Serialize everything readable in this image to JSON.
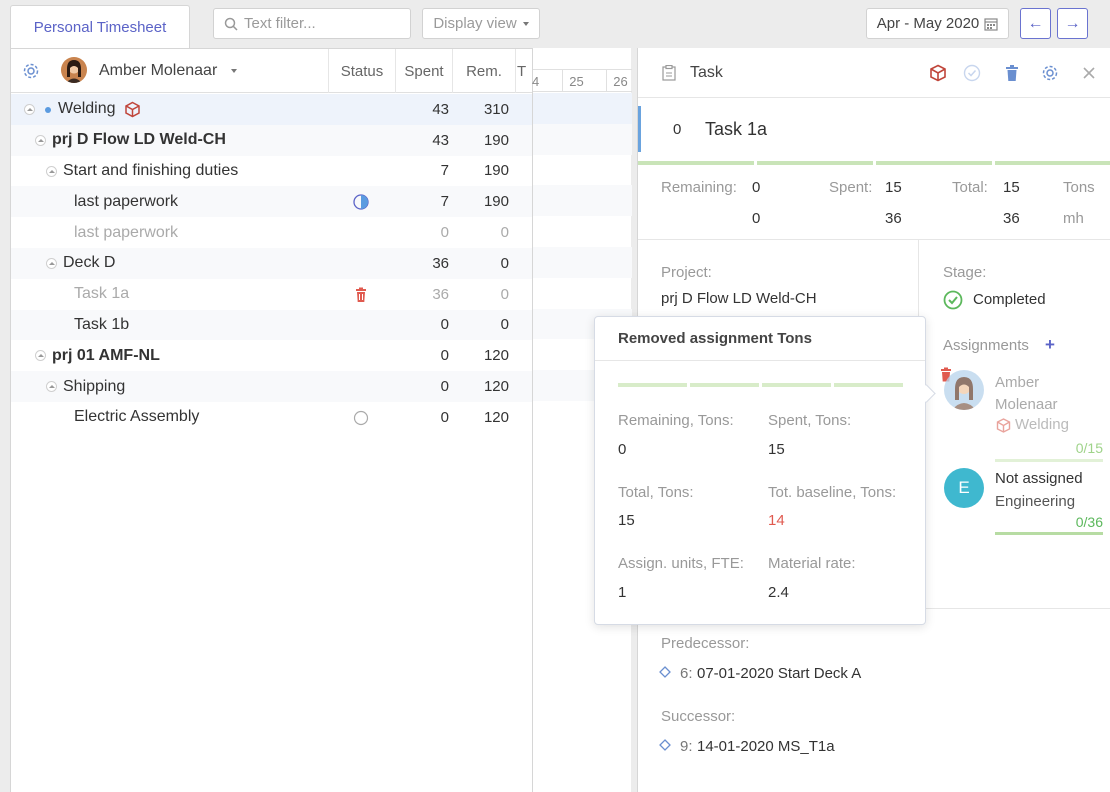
{
  "tabs": {
    "personal_timesheet": "Personal Timesheet"
  },
  "filter": {
    "placeholder": "Text filter..."
  },
  "display_view": "Display view",
  "date_range": "Apr - May 2020",
  "nav": {
    "prev": "←",
    "next": "→"
  },
  "table": {
    "user_name": "Amber Molenaar",
    "headers": {
      "status": "Status",
      "spent": "Spent",
      "rem": "Rem.",
      "t": "T"
    },
    "rows": [
      {
        "label": "Welding",
        "spent": "43",
        "rem": "310"
      },
      {
        "label": "prj D Flow LD Weld-CH",
        "spent": "43",
        "rem": "190"
      },
      {
        "label": "Start and finishing duties",
        "spent": "7",
        "rem": "190"
      },
      {
        "label": "last paperwork",
        "spent": "7",
        "rem": "190"
      },
      {
        "label": "last paperwork",
        "spent": "0",
        "rem": "0"
      },
      {
        "label": "Deck D",
        "spent": "36",
        "rem": "0"
      },
      {
        "label": "Task 1a",
        "spent": "36",
        "rem": "0"
      },
      {
        "label": "Task 1b",
        "spent": "0",
        "rem": "0"
      },
      {
        "label": "prj 01 AMF-NL",
        "spent": "0",
        "rem": "120"
      },
      {
        "label": "Shipping",
        "spent": "0",
        "rem": "120"
      },
      {
        "label": "Electric Assembly",
        "spent": "0",
        "rem": "120"
      }
    ]
  },
  "gantt": {
    "ticks": [
      "4",
      "25",
      "26"
    ]
  },
  "panel": {
    "title": "Task",
    "task_id": "0",
    "task_name": "Task 1a",
    "stats": {
      "remaining_label": "Remaining:",
      "spent_label": "Spent:",
      "total_label": "Total:",
      "remaining_tons": "0",
      "spent_tons": "15",
      "total_tons": "15",
      "unit_tons": "Tons",
      "remaining_mh": "0",
      "spent_mh": "36",
      "total_mh": "36",
      "unit_mh": "mh"
    },
    "project_label": "Project:",
    "project_value": "prj D Flow LD Weld-CH",
    "stage_label": "Stage:",
    "stage_value": "Completed",
    "assignments_label": "Assignments",
    "assignments": [
      {
        "name": "Amber Molenaar",
        "group": "Welding",
        "progress": "0/15"
      },
      {
        "initial": "E",
        "name": "Not assigned",
        "group": "Engineering",
        "progress": "0/36"
      }
    ],
    "predecessor_label": "Predecessor:",
    "predecessor_id": "6:",
    "predecessor_value": "07-01-2020 Start Deck A",
    "successor_label": "Successor:",
    "successor_id": "9:",
    "successor_value": "14-01-2020 MS_T1a"
  },
  "popup": {
    "title": "Removed assignment Tons",
    "remaining_label": "Remaining, Tons:",
    "remaining_value": "0",
    "spent_label": "Spent, Tons:",
    "spent_value": "15",
    "total_label": "Total, Tons:",
    "total_value": "15",
    "baseline_label": "Tot. baseline, Tons:",
    "baseline_value": "14",
    "units_label": "Assign. units, FTE:",
    "units_value": "1",
    "rate_label": "Material rate:",
    "rate_value": "2.4"
  },
  "colors": {
    "accent": "#5b63c7",
    "danger": "#e05a4f",
    "success": "#5cb85c",
    "cyan": "#3fb8cf"
  }
}
